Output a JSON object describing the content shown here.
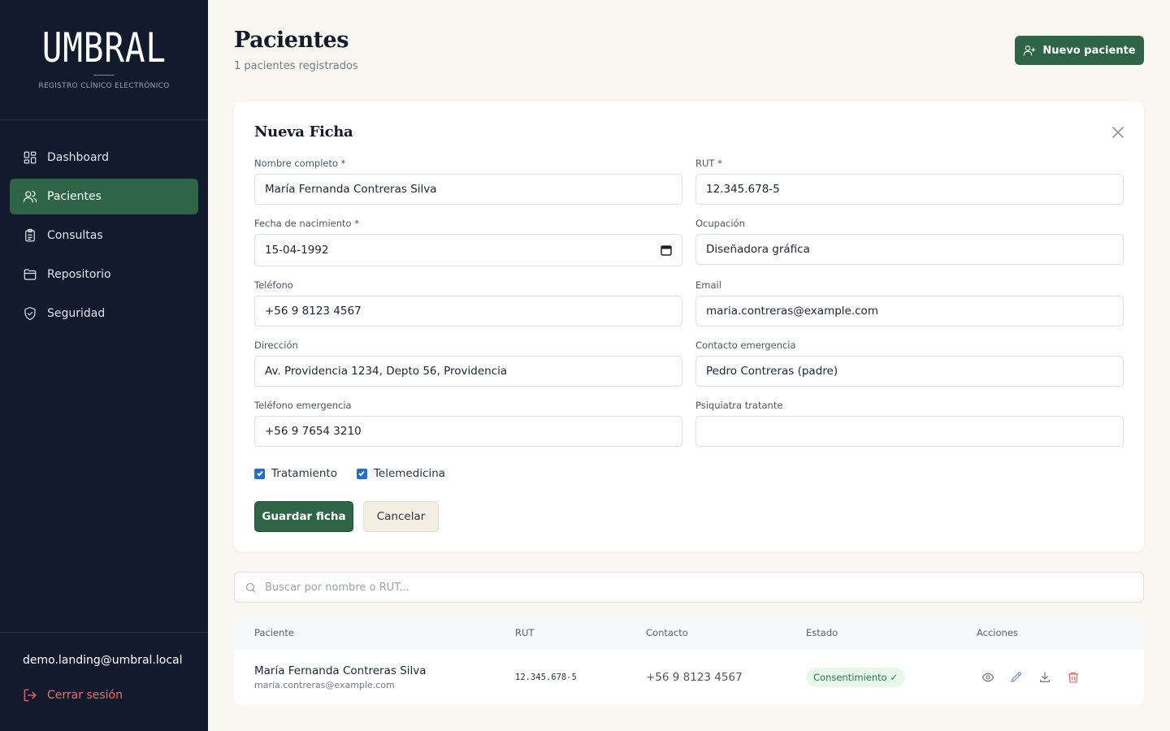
{
  "brand": {
    "name": "UMBRAL",
    "subtitle": "REGISTRO CLÍNICO ELECTRÓNICO"
  },
  "nav": {
    "items": [
      {
        "label": "Dashboard",
        "icon": "dashboard-icon"
      },
      {
        "label": "Pacientes",
        "icon": "users-icon",
        "active": true
      },
      {
        "label": "Consultas",
        "icon": "clipboard-icon"
      },
      {
        "label": "Repositorio",
        "icon": "folder-icon"
      },
      {
        "label": "Seguridad",
        "icon": "shield-icon"
      }
    ]
  },
  "user": {
    "email": "demo.landing@umbral.local",
    "logout_label": "Cerrar sesión"
  },
  "header": {
    "title": "Pacientes",
    "subtitle": "1 pacientes registrados",
    "new_button": "Nuevo paciente"
  },
  "form": {
    "title": "Nueva Ficha",
    "fields": {
      "nombre": {
        "label": "Nombre completo *",
        "value": "María Fernanda Contreras Silva"
      },
      "rut": {
        "label": "RUT *",
        "value": "12.345.678-5"
      },
      "nacimiento": {
        "label": "Fecha de nacimiento *",
        "value": "15-04-1992"
      },
      "ocupacion": {
        "label": "Ocupación",
        "value": "Diseñadora gráfica"
      },
      "telefono": {
        "label": "Teléfono",
        "value": "+56 9 8123 4567"
      },
      "email": {
        "label": "Email",
        "value": "maria.contreras@example.com"
      },
      "direccion": {
        "label": "Dirección",
        "value": "Av. Providencia 1234, Depto 56, Providencia"
      },
      "contacto": {
        "label": "Contacto emergencia",
        "value": "Pedro Contreras (padre)"
      },
      "tel_emergencia": {
        "label": "Teléfono emergencia",
        "value": "+56 9 7654 3210"
      },
      "psiquiatra": {
        "label": "Psiquiatra tratante",
        "value": ""
      }
    },
    "checks": {
      "tratamiento": "Tratamiento",
      "telemedicina": "Telemedicina"
    },
    "save_label": "Guardar ficha",
    "cancel_label": "Cancelar"
  },
  "search": {
    "placeholder": "Buscar por nombre o RUT..."
  },
  "table": {
    "headers": {
      "paciente": "Paciente",
      "rut": "RUT",
      "contacto": "Contacto",
      "estado": "Estado",
      "acciones": "Acciones"
    },
    "rows": [
      {
        "name": "María Fernanda Contreras Silva",
        "email": "maria.contreras@example.com",
        "rut": "12.345.678-5",
        "phone": "+56 9 8123 4567",
        "status": "Consentimiento ✓"
      }
    ]
  },
  "colors": {
    "sidebar": "#121b2e",
    "accent": "#2e6547",
    "danger": "#ef6b6b",
    "badge_bg": "#e8f6ec",
    "badge_text": "#27794a"
  }
}
